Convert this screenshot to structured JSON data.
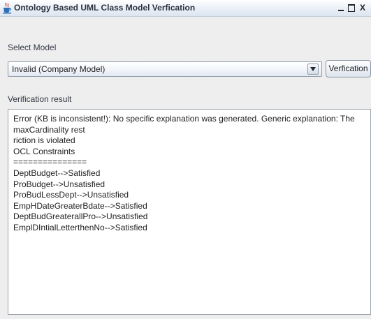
{
  "window": {
    "title": "Ontology Based UML Class Model Verfication",
    "controls": {
      "minimize": "_",
      "maximize": "□",
      "close": "X"
    }
  },
  "select_model": {
    "label": "Select Model",
    "selected_value": "Invalid (Company Model)"
  },
  "verify_button": {
    "label": "Verfication"
  },
  "verification_result": {
    "label": "Verification result",
    "text": "Error (KB is inconsistent!): No specific explanation was generated. Generic explanation: The maxCardinality rest\nriction is violated\nOCL Constraints\n===============\nDeptBudget-->Satisfied\nProBudget-->Unsatisfied\nProBudLessDept-->Unsatisfied\nEmpHDateGreaterBdate-->Satisfied\nDeptBudGreaterallPro-->Unsatisfied\nEmplDIntialLetterthenNo-->Satisfied"
  },
  "icons": {
    "app": "java-cup-icon",
    "combo_arrow": "chevron-down-icon"
  }
}
